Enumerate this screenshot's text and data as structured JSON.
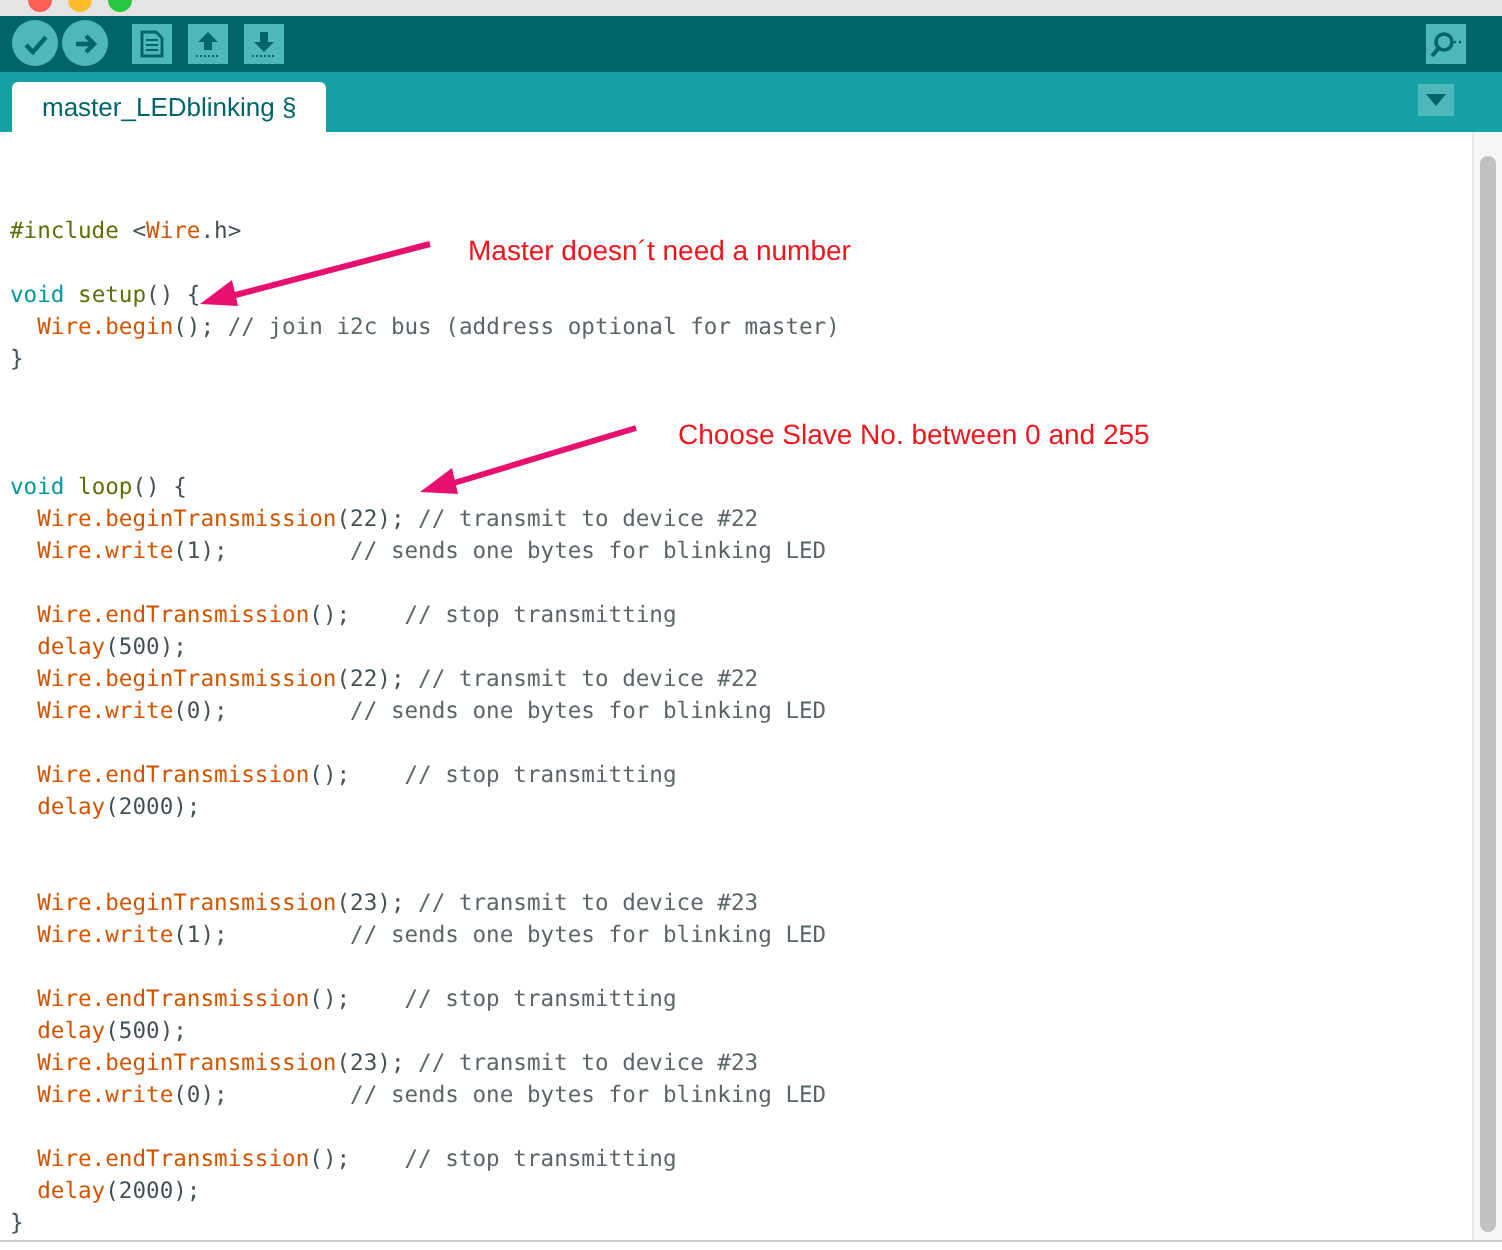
{
  "toolbar": {
    "buttons": [
      {
        "kind": "verify"
      },
      {
        "kind": "upload"
      },
      {
        "kind": "new"
      },
      {
        "kind": "open"
      },
      {
        "kind": "save"
      }
    ],
    "right_buttons": [
      {
        "kind": "serial"
      }
    ]
  },
  "tabs": [
    {
      "label": "master_LEDblinking §",
      "selected": true
    }
  ],
  "code": [
    {
      "kind": "blank"
    },
    {
      "kind": "blank"
    },
    {
      "kind": "code",
      "tokens": [
        {
          "kind": "pre",
          "text": "#include"
        },
        {
          "kind": "plain",
          "text": " <"
        },
        {
          "kind": "lib",
          "text": "Wire"
        },
        {
          "kind": "plain",
          "text": ".h>"
        }
      ]
    },
    {
      "kind": "blank"
    },
    {
      "kind": "code",
      "tokens": [
        {
          "kind": "kw",
          "text": "void"
        },
        {
          "kind": "fn",
          "text": " setup"
        },
        {
          "kind": "plain",
          "text": "() {"
        }
      ]
    },
    {
      "kind": "code",
      "tokens": [
        {
          "kind": "lib",
          "text": "  Wire.begin"
        },
        {
          "kind": "plain",
          "text": "(); "
        },
        {
          "kind": "cmt",
          "text": "// join i2c bus (address optional for master)"
        }
      ]
    },
    {
      "kind": "code",
      "tokens": [
        {
          "kind": "plain",
          "text": "}"
        }
      ]
    },
    {
      "kind": "blank"
    },
    {
      "kind": "blank"
    },
    {
      "kind": "blank"
    },
    {
      "kind": "code",
      "tokens": [
        {
          "kind": "kw",
          "text": "void"
        },
        {
          "kind": "fn",
          "text": " loop"
        },
        {
          "kind": "plain",
          "text": "() {"
        }
      ]
    },
    {
      "kind": "code",
      "tokens": [
        {
          "kind": "lib",
          "text": "  Wire.beginTransmission"
        },
        {
          "kind": "plain",
          "text": "(22); "
        },
        {
          "kind": "cmt",
          "text": "// transmit to device #22"
        }
      ]
    },
    {
      "kind": "code",
      "tokens": [
        {
          "kind": "lib",
          "text": "  Wire.write"
        },
        {
          "kind": "plain",
          "text": "(1);         "
        },
        {
          "kind": "cmt",
          "text": "// sends one bytes for blinking LED"
        }
      ]
    },
    {
      "kind": "blank"
    },
    {
      "kind": "code",
      "tokens": [
        {
          "kind": "lib",
          "text": "  Wire.endTransmission"
        },
        {
          "kind": "plain",
          "text": "();    "
        },
        {
          "kind": "cmt",
          "text": "// stop transmitting"
        }
      ]
    },
    {
      "kind": "code",
      "tokens": [
        {
          "kind": "lib",
          "text": "  delay"
        },
        {
          "kind": "plain",
          "text": "(500);"
        }
      ]
    },
    {
      "kind": "code",
      "tokens": [
        {
          "kind": "lib",
          "text": "  Wire.beginTransmission"
        },
        {
          "kind": "plain",
          "text": "(22); "
        },
        {
          "kind": "cmt",
          "text": "// transmit to device #22"
        }
      ]
    },
    {
      "kind": "code",
      "tokens": [
        {
          "kind": "lib",
          "text": "  Wire.write"
        },
        {
          "kind": "plain",
          "text": "(0);         "
        },
        {
          "kind": "cmt",
          "text": "// sends one bytes for blinking LED"
        }
      ]
    },
    {
      "kind": "blank"
    },
    {
      "kind": "code",
      "tokens": [
        {
          "kind": "lib",
          "text": "  Wire.endTransmission"
        },
        {
          "kind": "plain",
          "text": "();    "
        },
        {
          "kind": "cmt",
          "text": "// stop transmitting"
        }
      ]
    },
    {
      "kind": "code",
      "tokens": [
        {
          "kind": "lib",
          "text": "  delay"
        },
        {
          "kind": "plain",
          "text": "(2000);"
        }
      ]
    },
    {
      "kind": "blank"
    },
    {
      "kind": "blank"
    },
    {
      "kind": "code",
      "tokens": [
        {
          "kind": "lib",
          "text": "  Wire.beginTransmission"
        },
        {
          "kind": "plain",
          "text": "(23); "
        },
        {
          "kind": "cmt",
          "text": "// transmit to device #23"
        }
      ]
    },
    {
      "kind": "code",
      "tokens": [
        {
          "kind": "lib",
          "text": "  Wire.write"
        },
        {
          "kind": "plain",
          "text": "(1);         "
        },
        {
          "kind": "cmt",
          "text": "// sends one bytes for blinking LED"
        }
      ]
    },
    {
      "kind": "blank"
    },
    {
      "kind": "code",
      "tokens": [
        {
          "kind": "lib",
          "text": "  Wire.endTransmission"
        },
        {
          "kind": "plain",
          "text": "();    "
        },
        {
          "kind": "cmt",
          "text": "// stop transmitting"
        }
      ]
    },
    {
      "kind": "code",
      "tokens": [
        {
          "kind": "lib",
          "text": "  delay"
        },
        {
          "kind": "plain",
          "text": "(500);"
        }
      ]
    },
    {
      "kind": "code",
      "tokens": [
        {
          "kind": "lib",
          "text": "  Wire.beginTransmission"
        },
        {
          "kind": "plain",
          "text": "(23); "
        },
        {
          "kind": "cmt",
          "text": "// transmit to device #23"
        }
      ]
    },
    {
      "kind": "code",
      "tokens": [
        {
          "kind": "lib",
          "text": "  Wire.write"
        },
        {
          "kind": "plain",
          "text": "(0);         "
        },
        {
          "kind": "cmt",
          "text": "// sends one bytes for blinking LED"
        }
      ]
    },
    {
      "kind": "blank"
    },
    {
      "kind": "code",
      "tokens": [
        {
          "kind": "lib",
          "text": "  Wire.endTransmission"
        },
        {
          "kind": "plain",
          "text": "();    "
        },
        {
          "kind": "cmt",
          "text": "// stop transmitting"
        }
      ]
    },
    {
      "kind": "code",
      "tokens": [
        {
          "kind": "lib",
          "text": "  delay"
        },
        {
          "kind": "plain",
          "text": "(2000);"
        }
      ]
    },
    {
      "kind": "code",
      "tokens": [
        {
          "kind": "plain",
          "text": "}"
        }
      ]
    }
  ],
  "annotations": [
    {
      "text": "Master doesn´t need a number"
    },
    {
      "text": "Choose Slave No. between 0 and 255"
    }
  ]
}
